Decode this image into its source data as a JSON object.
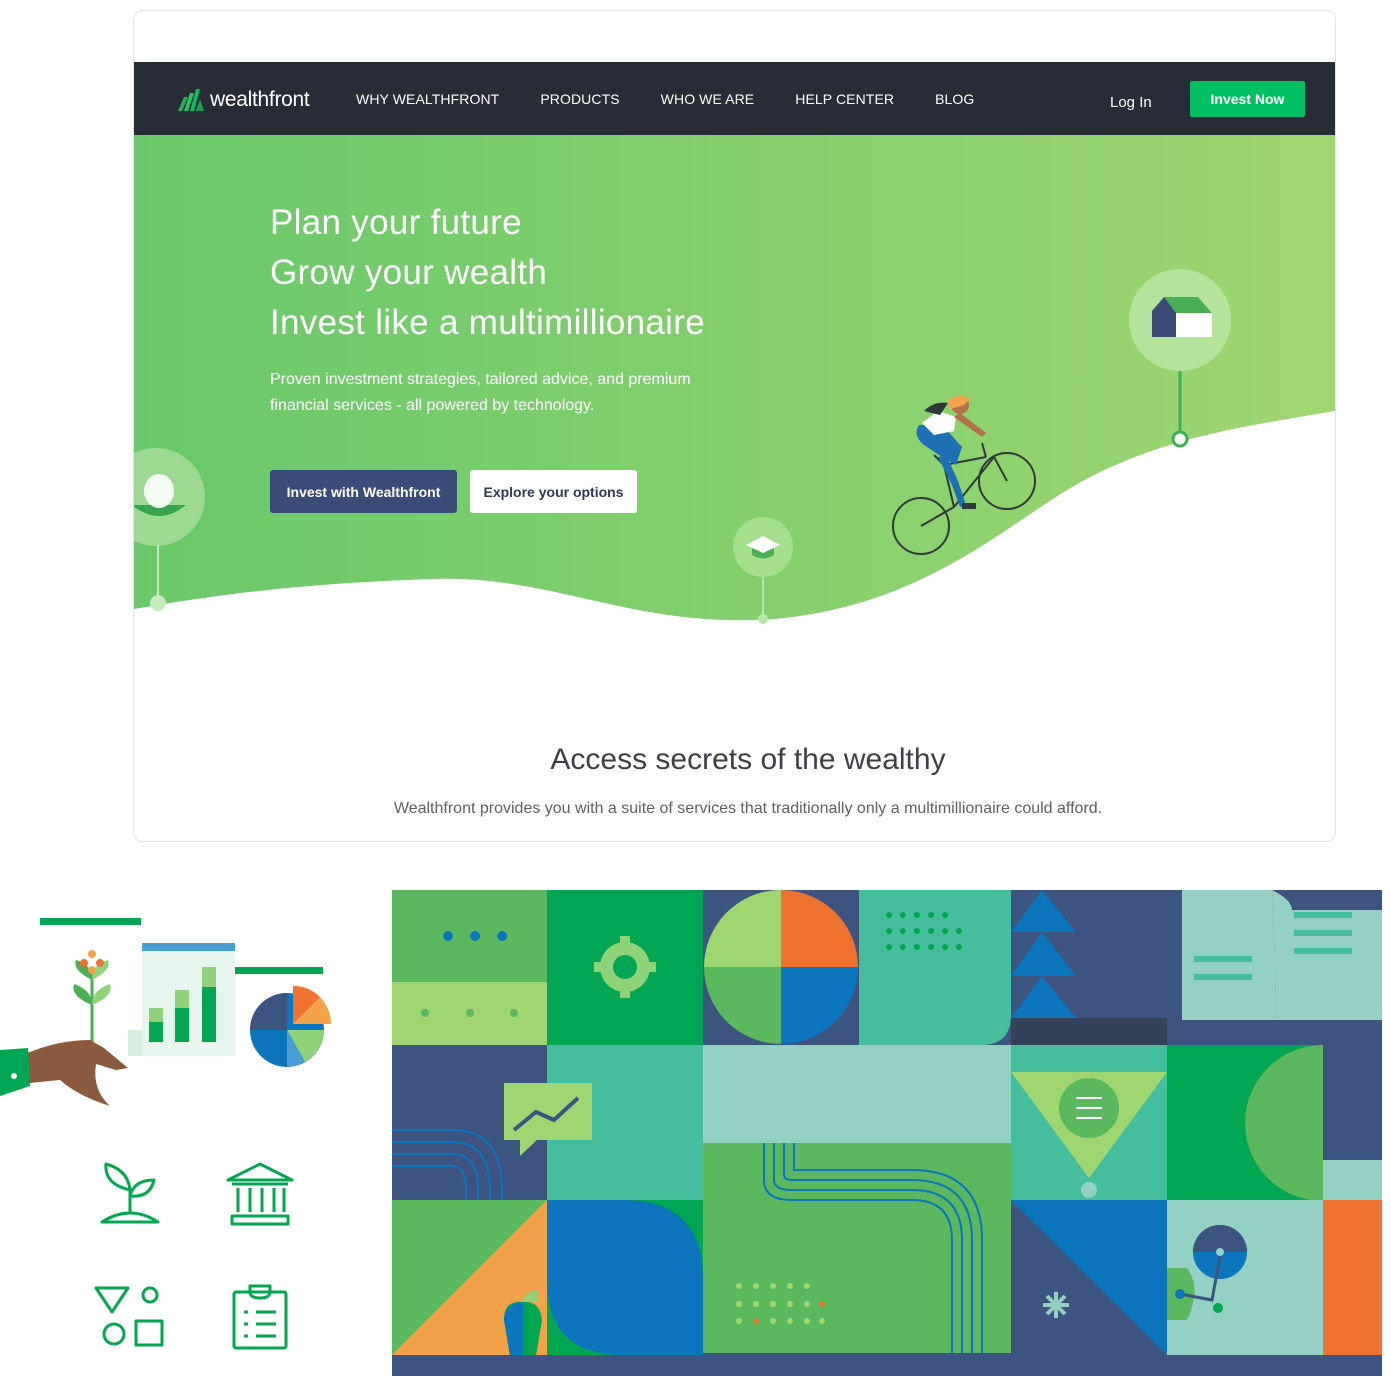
{
  "nav": {
    "logo_text": "wealthfront",
    "links": [
      "WHY WEALTHFRONT",
      "PRODUCTS",
      "WHO WE ARE",
      "HELP CENTER",
      "BLOG"
    ],
    "login": "Log In",
    "cta": "Invest Now"
  },
  "hero": {
    "headlines": [
      "Plan your future",
      "Grow your wealth",
      "Invest like a multimillionaire"
    ],
    "subtext": "Proven investment strategies, tailored advice, and premium financial services - all powered by technology.",
    "primary_button": "Invest with Wealthfront",
    "secondary_button": "Explore your options"
  },
  "section": {
    "title": "Access secrets of the wealthy",
    "subtitle": "Wealthfront provides you with a suite of services that traditionally only a multimillionaire could afford."
  },
  "icons": [
    "sprout-icon",
    "bank-icon",
    "shapes-icon",
    "clipboard-icon",
    "house-icon",
    "graduation-cap-icon",
    "egg-icon",
    "gear-icon",
    "chart-icon",
    "apple-icon"
  ],
  "colors": {
    "nav_bg": "#282c36",
    "accent_green": "#00c061",
    "hero_green": "#6fc96a",
    "primary_button": "#3a4b78",
    "mosaic_navy": "#3d5380",
    "mosaic_blue": "#0b75bd",
    "mosaic_orange": "#ee7330"
  }
}
